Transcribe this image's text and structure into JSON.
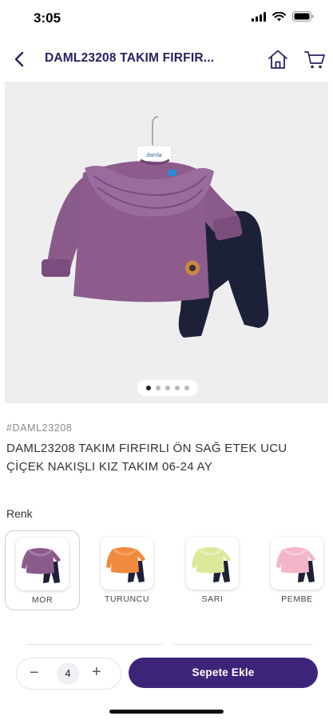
{
  "status_bar": {
    "time": "3:05"
  },
  "header": {
    "title": "DAML23208 TAKIM FIRFIR..."
  },
  "product": {
    "sku": "#DAML23208",
    "title": "DAML23208 TAKIM FIRFIRLI ÖN SAĞ ETEK UCU ÇİÇEK NAKIŞLI KIZ TAKIM 06-24 AY",
    "image_count": 5,
    "active_image": 1,
    "hanger_brand": "damla"
  },
  "colors": {
    "label": "Renk",
    "options": [
      {
        "name": "MOR",
        "top_color": "#8a5a8a",
        "selected": true
      },
      {
        "name": "TURUNCU",
        "top_color": "#f08a3e",
        "selected": false
      },
      {
        "name": "SARI",
        "top_color": "#dde79a",
        "selected": false
      },
      {
        "name": "PEMBE",
        "top_color": "#f3b6c8",
        "selected": false
      }
    ],
    "pants_color": "#1d2138"
  },
  "purchase": {
    "quantity": "4",
    "minus": "−",
    "plus": "+",
    "add_to_cart_label": "Sepete Ekle"
  },
  "theme": {
    "accent": "#3c2579",
    "title_color": "#2a2160"
  }
}
